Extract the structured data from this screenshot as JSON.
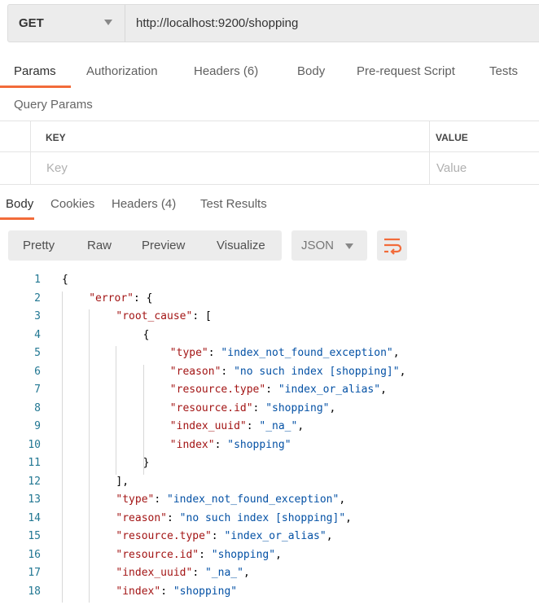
{
  "request": {
    "method": "GET",
    "url": "http://localhost:9200/shopping"
  },
  "request_tabs": [
    {
      "label": "Params"
    },
    {
      "label": "Authorization"
    },
    {
      "label": "Headers",
      "count": "(6)"
    },
    {
      "label": "Body"
    },
    {
      "label": "Pre-request Script"
    },
    {
      "label": "Tests"
    }
  ],
  "query_params": {
    "title": "Query Params",
    "key_header": "KEY",
    "value_header": "VALUE",
    "key_placeholder": "Key",
    "value_placeholder": "Value"
  },
  "response_tabs": [
    {
      "label": "Body"
    },
    {
      "label": "Cookies"
    },
    {
      "label": "Headers",
      "count": "(4)"
    },
    {
      "label": "Test Results"
    }
  ],
  "view_modes": [
    "Pretty",
    "Raw",
    "Preview",
    "Visualize"
  ],
  "format": "JSON",
  "colors": {
    "accent": "#f26b3a",
    "key": "#a31515",
    "value": "#0451a5",
    "count": "#26a552"
  },
  "icons": {
    "wrap": "wrap-lines-icon",
    "dropdown": "caret-down-icon"
  },
  "code_lines": [
    {
      "indent": 0,
      "pre": "{"
    },
    {
      "indent": 1,
      "key": "\"error\"",
      "post": ": {"
    },
    {
      "indent": 2,
      "key": "\"root_cause\"",
      "post": ": ["
    },
    {
      "indent": 3,
      "pre": "{"
    },
    {
      "indent": 4,
      "key": "\"type\"",
      "val": "\"index_not_found_exception\"",
      "post": ","
    },
    {
      "indent": 4,
      "key": "\"reason\"",
      "val": "\"no such index [shopping]\"",
      "post": ","
    },
    {
      "indent": 4,
      "key": "\"resource.type\"",
      "val": "\"index_or_alias\"",
      "post": ","
    },
    {
      "indent": 4,
      "key": "\"resource.id\"",
      "val": "\"shopping\"",
      "post": ","
    },
    {
      "indent": 4,
      "key": "\"index_uuid\"",
      "val": "\"_na_\"",
      "post": ","
    },
    {
      "indent": 4,
      "key": "\"index\"",
      "val": "\"shopping\""
    },
    {
      "indent": 3,
      "pre": "}"
    },
    {
      "indent": 2,
      "pre": "],"
    },
    {
      "indent": 2,
      "key": "\"type\"",
      "val": "\"index_not_found_exception\"",
      "post": ","
    },
    {
      "indent": 2,
      "key": "\"reason\"",
      "val": "\"no such index [shopping]\"",
      "post": ","
    },
    {
      "indent": 2,
      "key": "\"resource.type\"",
      "val": "\"index_or_alias\"",
      "post": ","
    },
    {
      "indent": 2,
      "key": "\"resource.id\"",
      "val": "\"shopping\"",
      "post": ","
    },
    {
      "indent": 2,
      "key": "\"index_uuid\"",
      "val": "\"_na_\"",
      "post": ","
    },
    {
      "indent": 2,
      "key": "\"index\"",
      "val": "\"shopping\""
    }
  ]
}
